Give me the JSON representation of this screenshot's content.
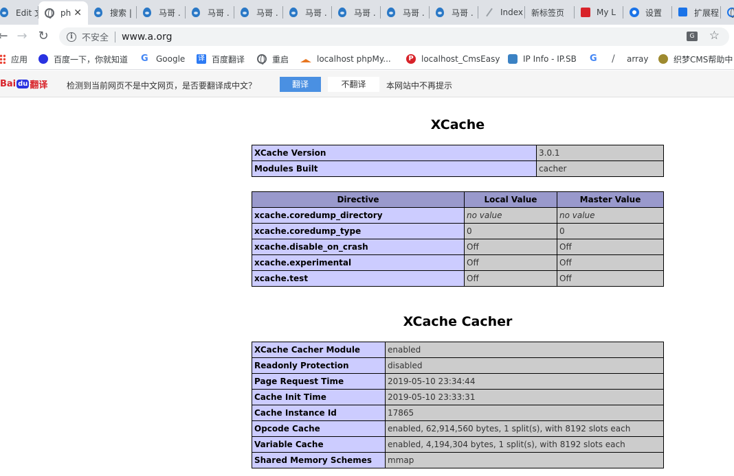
{
  "browser": {
    "tabs": [
      {
        "label": "Edit 文",
        "icon": "drupal-icon"
      },
      {
        "label": "ph",
        "icon": "globe-icon",
        "active": true
      },
      {
        "label": "搜索 |",
        "icon": "drupal-icon"
      },
      {
        "label": "马哥 .",
        "icon": "drupal-icon"
      },
      {
        "label": "马哥 .",
        "icon": "drupal-icon"
      },
      {
        "label": "马哥 .",
        "icon": "drupal-icon"
      },
      {
        "label": "马哥 .",
        "icon": "drupal-icon"
      },
      {
        "label": "马哥 .",
        "icon": "drupal-icon"
      },
      {
        "label": "马哥 .",
        "icon": "drupal-icon"
      },
      {
        "label": "马哥 .",
        "icon": "drupal-icon"
      },
      {
        "label": "Index",
        "icon": "index-icon"
      },
      {
        "label": "新标签页",
        "icon": ""
      },
      {
        "label": "My L",
        "icon": "myl-icon"
      },
      {
        "label": "设置",
        "icon": "settings-icon"
      },
      {
        "label": "扩展程",
        "icon": "extension-icon"
      }
    ],
    "close_glyph": "✕",
    "security_label": "不安全",
    "url": "www.a.org",
    "bookmarks": [
      {
        "label": "应用",
        "icon": "apps-grid-icon"
      },
      {
        "label": "百度一下，你就知道",
        "icon": "baidu-paw-icon"
      },
      {
        "label": "Google",
        "icon": "google-icon"
      },
      {
        "label": "百度翻译",
        "icon": "baidu-translate-icon"
      },
      {
        "label": "重启",
        "icon": "globe-icon"
      },
      {
        "label": "localhost phpMy...",
        "icon": "phpmyadmin-icon"
      },
      {
        "label": "localhost_CmsEasy",
        "icon": "cmseasy-icon"
      },
      {
        "label": "IP Info - IP.SB",
        "icon": "ipsb-icon"
      },
      {
        "label": "",
        "icon": "google-icon"
      },
      {
        "label": "array",
        "icon": "slash-icon"
      },
      {
        "label": "织梦CMS帮助中",
        "icon": "dedecms-icon"
      }
    ]
  },
  "translate_bar": {
    "logo": {
      "part1": "Bai",
      "part2": "du",
      "part3": "翻译"
    },
    "message": "检测到当前网页不是中文网页，是否要翻译成中文？",
    "translate_button": "翻译",
    "no_translate_button": "不翻译",
    "never_label": "本网站中不再提示"
  },
  "page": {
    "title": "XCache",
    "info_table": [
      {
        "name": "XCache Version",
        "value": "3.0.1"
      },
      {
        "name": "Modules Built",
        "value": "cacher"
      }
    ],
    "directive_headers": [
      "Directive",
      "Local Value",
      "Master Value"
    ],
    "directives": [
      {
        "name": "xcache.coredump_directory",
        "local": "no value",
        "master": "no value",
        "novalue": true
      },
      {
        "name": "xcache.coredump_type",
        "local": "0",
        "master": "0"
      },
      {
        "name": "xcache.disable_on_crash",
        "local": "Off",
        "master": "Off"
      },
      {
        "name": "xcache.experimental",
        "local": "Off",
        "master": "Off"
      },
      {
        "name": "xcache.test",
        "local": "Off",
        "master": "Off"
      }
    ],
    "cacher_title": "XCache Cacher",
    "cacher_table": [
      {
        "name": "XCache Cacher Module",
        "value": "enabled"
      },
      {
        "name": "Readonly Protection",
        "value": "disabled"
      },
      {
        "name": "Page Request Time",
        "value": "2019-05-10 23:34:44"
      },
      {
        "name": "Cache Init Time",
        "value": "2019-05-10 23:33:31"
      },
      {
        "name": "Cache Instance Id",
        "value": "17865"
      },
      {
        "name": "Opcode Cache",
        "value": "enabled, 62,914,560 bytes, 1 split(s), with 8192 slots each"
      },
      {
        "name": "Variable Cache",
        "value": "enabled, 4,194,304 bytes, 1 split(s), with 8192 slots each"
      },
      {
        "name": "Shared Memory Schemes",
        "value": "mmap"
      }
    ]
  }
}
